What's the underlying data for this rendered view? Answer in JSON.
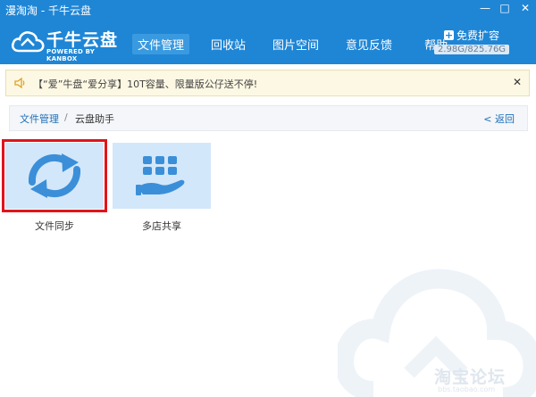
{
  "window": {
    "title": "漫淘淘 - 千牛云盘",
    "min_glyph": "—",
    "max_glyph": "□",
    "close_glyph": "✕"
  },
  "logo": {
    "brand": "千牛云盘",
    "powered": "POWERED BY KANBOX"
  },
  "nav": {
    "items": [
      {
        "label": "文件管理",
        "active": true
      },
      {
        "label": "回收站",
        "active": false
      },
      {
        "label": "图片空间",
        "active": false
      },
      {
        "label": "意见反馈",
        "active": false
      },
      {
        "label": "帮助",
        "active": false
      }
    ]
  },
  "storage": {
    "expand_label": "免费扩容",
    "plus_glyph": "+",
    "usage": "2.98G/825.76G"
  },
  "notice": {
    "text": "【“爱”牛盘“爱分享】10T容量、限量版公仔送不停!",
    "close_glyph": "✕"
  },
  "breadcrumb": {
    "root": "文件管理",
    "separator": "/",
    "current": "云盘助手",
    "back": "< 返回"
  },
  "tools": [
    {
      "label": "文件同步",
      "icon": "sync-icon",
      "selected": true
    },
    {
      "label": "多店共享",
      "icon": "shop-share-icon",
      "selected": false
    }
  ],
  "watermark": {
    "text": "淘宝论坛",
    "url": "bbs.taobao.com"
  },
  "colors": {
    "brand_blue": "#1f86d6",
    "tile_bg": "#d3e7fa",
    "selection_red": "#e0141b",
    "notice_bg": "#fcf8e3",
    "link_blue": "#1e6fb8"
  }
}
